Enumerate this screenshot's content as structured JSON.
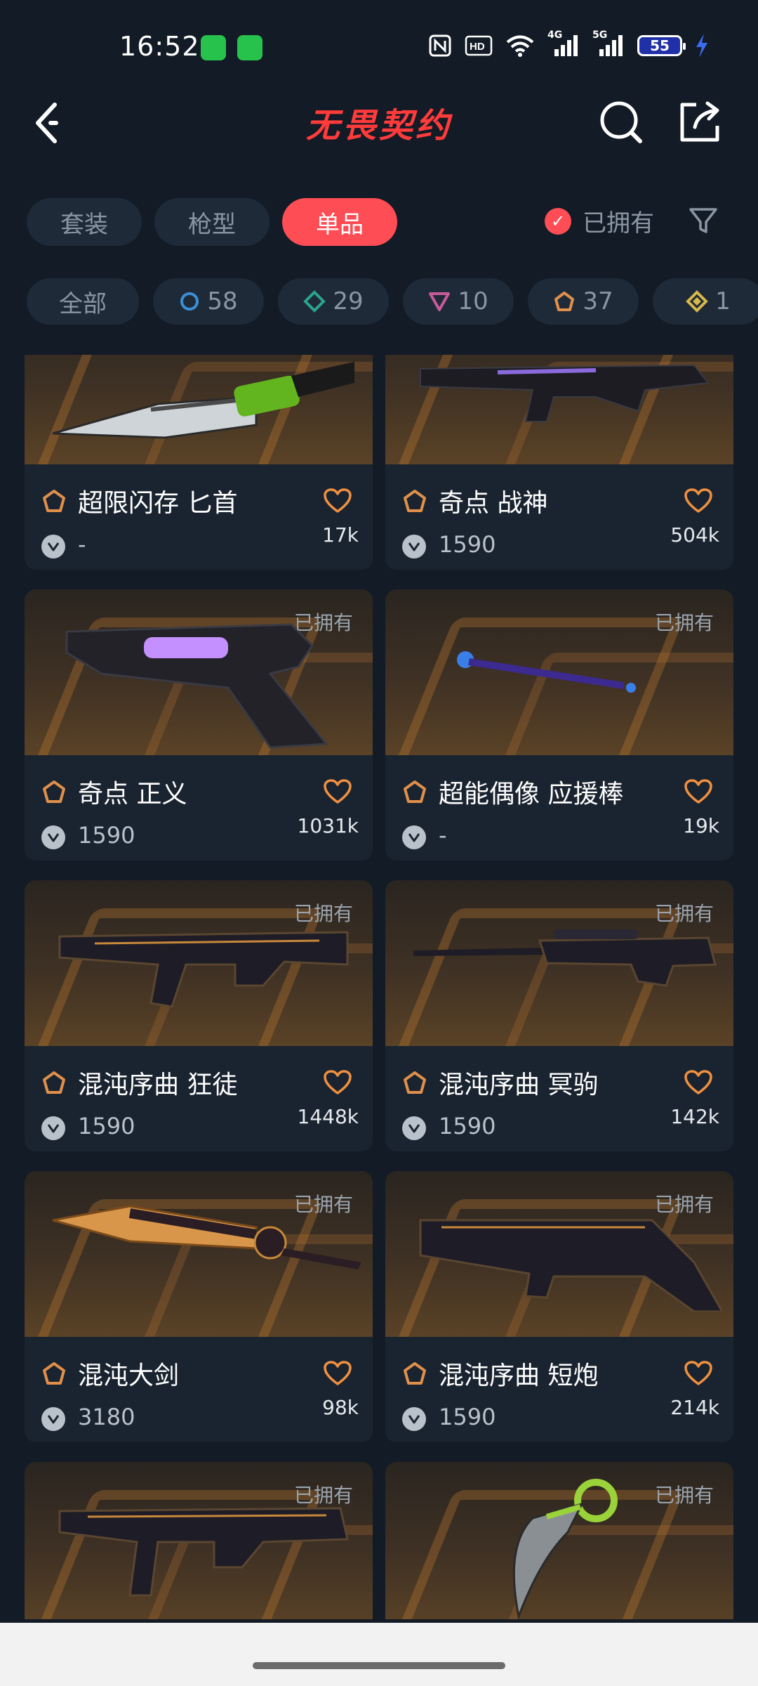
{
  "status_bar": {
    "time": "16:52",
    "battery": "55",
    "network_1": "4G",
    "network_2": "5G"
  },
  "header": {
    "title": "无畏契约"
  },
  "tabs": [
    {
      "label": "套装",
      "active": false
    },
    {
      "label": "枪型",
      "active": false
    },
    {
      "label": "单品",
      "active": true
    }
  ],
  "owned_filter": {
    "label": "已拥有",
    "checked": true
  },
  "tiers": [
    {
      "label": "全部",
      "icon": "all"
    },
    {
      "label": "58",
      "icon": "select-tier-circle-icon",
      "color": "#3a8fd6"
    },
    {
      "label": "29",
      "icon": "deluxe-tier-diamond-icon",
      "color": "#2aa58a"
    },
    {
      "label": "10",
      "icon": "premium-tier-triangle-icon",
      "color": "#c85a9a"
    },
    {
      "label": "37",
      "icon": "exclusive-tier-pentagon-icon",
      "color": "#e0904a"
    },
    {
      "label": "1",
      "icon": "ultra-tier-diamond-icon",
      "color": "#d8b84a"
    }
  ],
  "colors": {
    "accent": "#ff4d55",
    "background": "#121b26",
    "chip": "#1e2a38",
    "tier_orange": "#e0904a",
    "heart": "#f09040"
  },
  "cards": [
    {
      "name": "超限闪存 匕首",
      "price": "-",
      "likes": "17k",
      "owned": false,
      "owned_label": ""
    },
    {
      "name": "奇点 战神",
      "price": "1590",
      "likes": "504k",
      "owned": false,
      "owned_label": ""
    },
    {
      "name": "奇点 正义",
      "price": "1590",
      "likes": "1031k",
      "owned": true,
      "owned_label": "已拥有"
    },
    {
      "name": "超能偶像 应援棒",
      "price": "-",
      "likes": "19k",
      "owned": true,
      "owned_label": "已拥有"
    },
    {
      "name": "混沌序曲 狂徒",
      "price": "1590",
      "likes": "1448k",
      "owned": true,
      "owned_label": "已拥有"
    },
    {
      "name": "混沌序曲 冥驹",
      "price": "1590",
      "likes": "142k",
      "owned": true,
      "owned_label": "已拥有"
    },
    {
      "name": "混沌大剑",
      "price": "3180",
      "likes": "98k",
      "owned": true,
      "owned_label": "已拥有"
    },
    {
      "name": "混沌序曲 短炮",
      "price": "1590",
      "likes": "214k",
      "owned": true,
      "owned_label": "已拥有"
    },
    {
      "name": "",
      "price": "",
      "likes": "",
      "owned": true,
      "owned_label": "已拥有"
    },
    {
      "name": "",
      "price": "",
      "likes": "",
      "owned": true,
      "owned_label": "已拥有"
    }
  ]
}
